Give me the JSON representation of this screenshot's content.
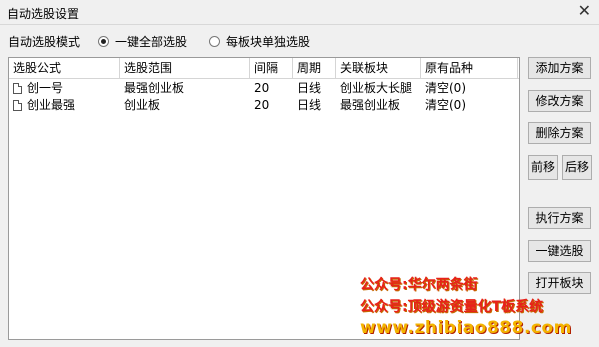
{
  "window": {
    "title": "自动选股设置",
    "close_symbol": "✕"
  },
  "mode": {
    "label": "自动选股模式",
    "options": [
      {
        "label": "一键全部选股",
        "selected": true
      },
      {
        "label": "每板块单独选股",
        "selected": false
      }
    ]
  },
  "table": {
    "columns": [
      "选股公式",
      "选股范围",
      "间隔",
      "周期",
      "关联板块",
      "原有品种"
    ],
    "rows": [
      [
        "创一号",
        "最强创业板",
        "20",
        "日线",
        "创业板大长腿",
        "清空(0)"
      ],
      [
        "创业最强",
        "创业板",
        "20",
        "日线",
        "最强创业板",
        "清空(0)"
      ]
    ]
  },
  "buttons": {
    "add": "添加方案",
    "modify": "修改方案",
    "delete": "删除方案",
    "move_up": "前移",
    "move_down": "后移",
    "execute": "执行方案",
    "one_click": "一键选股",
    "open_block": "打开板块"
  },
  "watermark": {
    "line1": "公众号:华尔两条街",
    "line2": "公众号:顶级游资量化T板系统",
    "line3": "www.zhibiao888.com"
  }
}
